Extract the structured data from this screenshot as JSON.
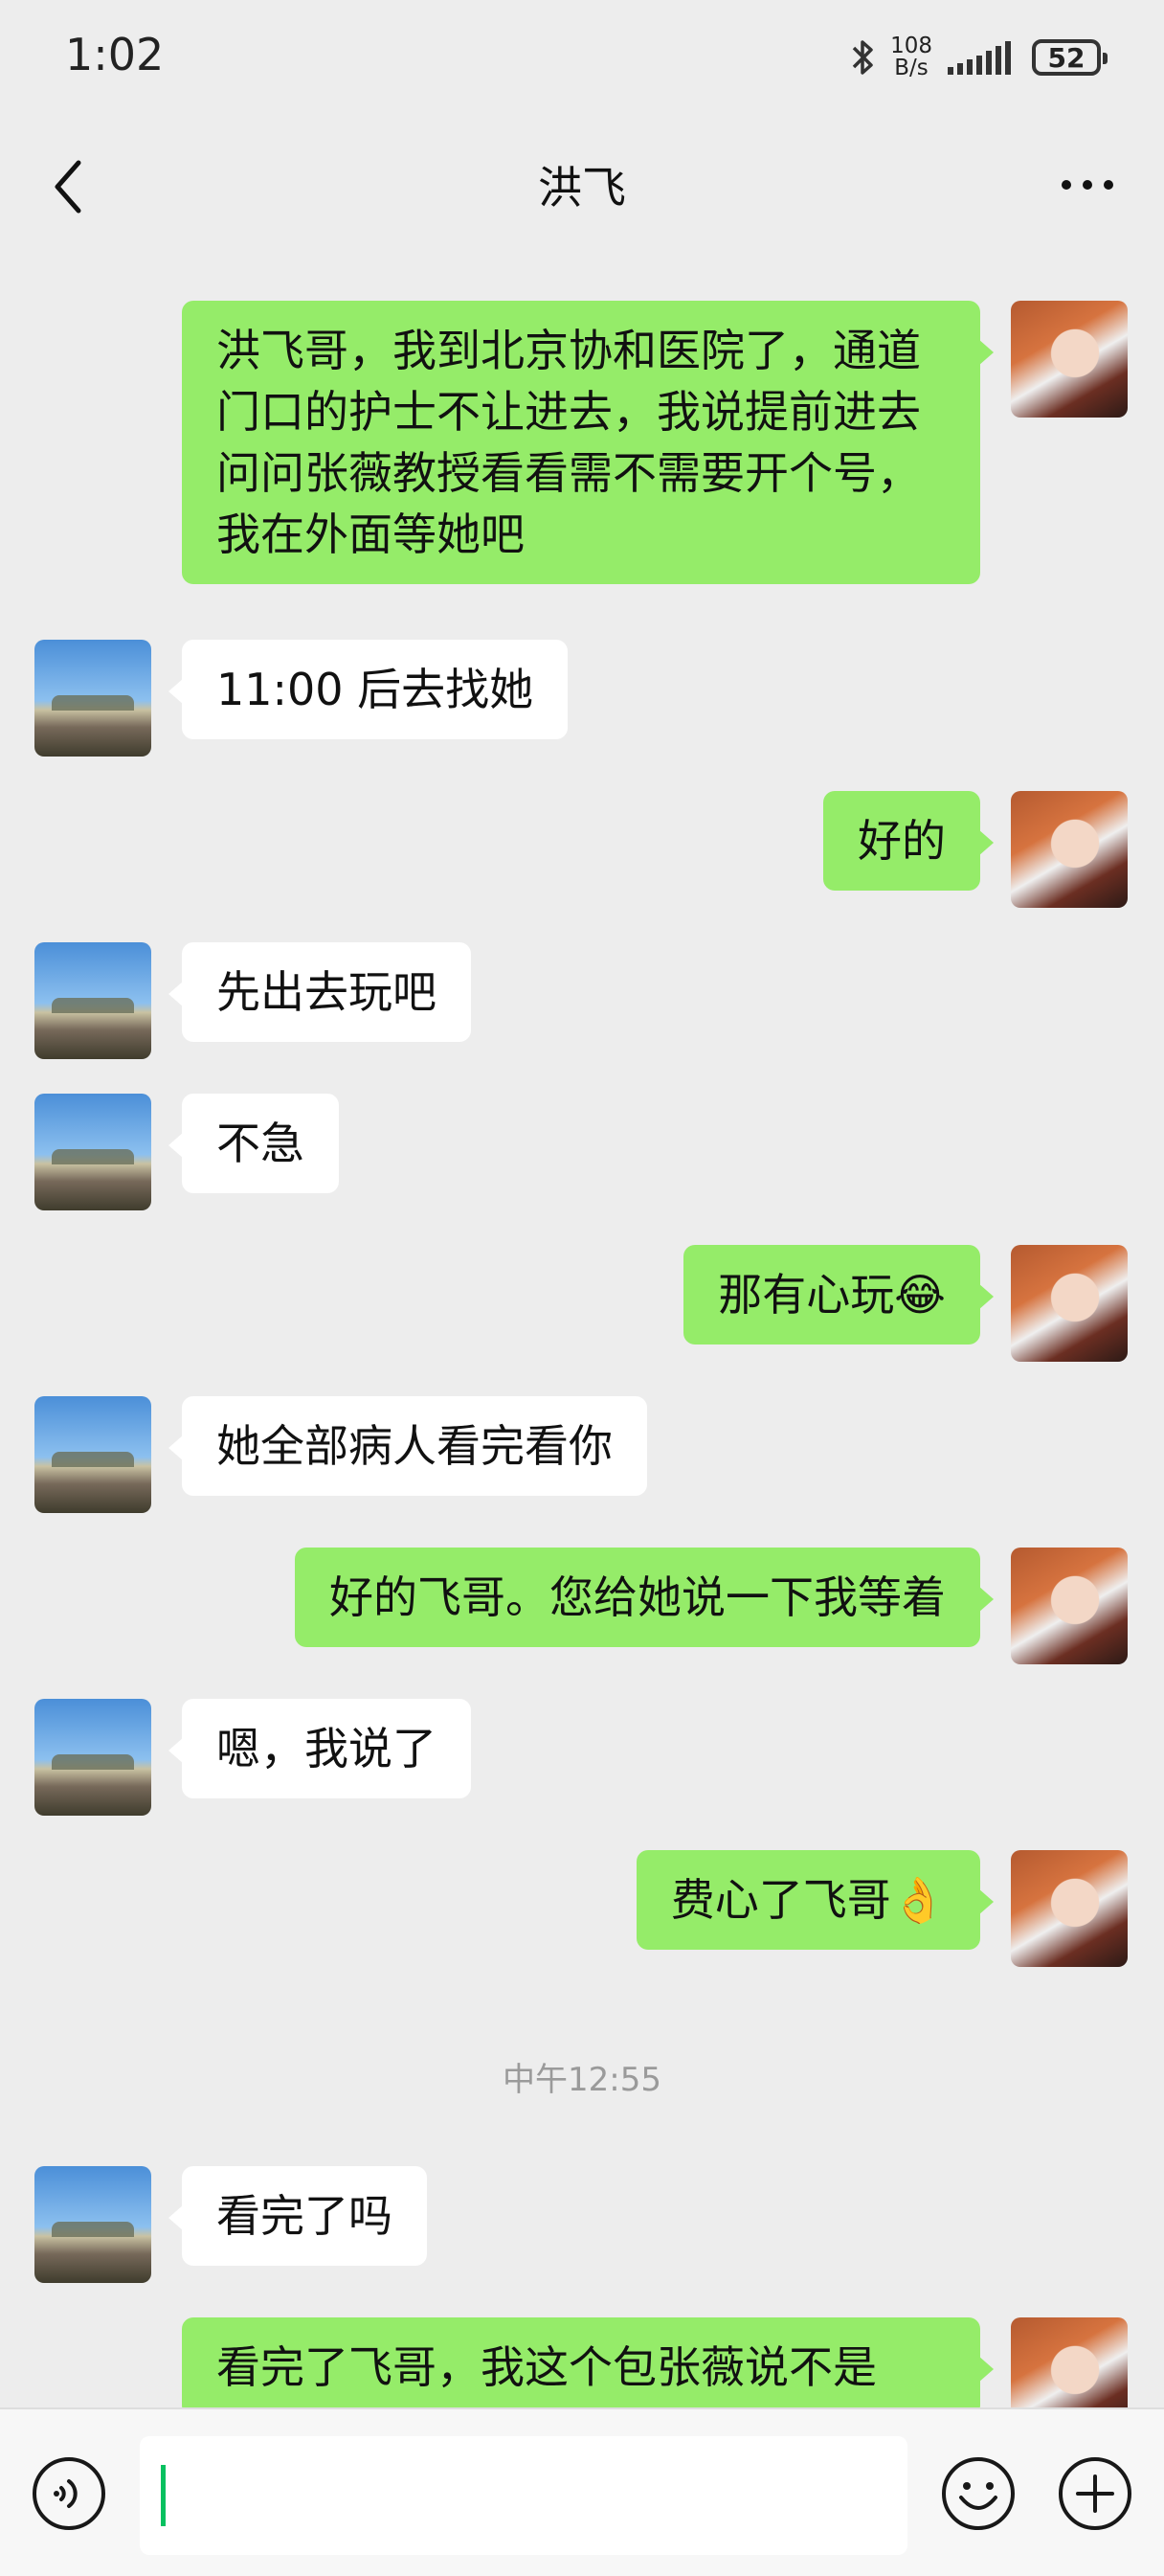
{
  "status_bar": {
    "time": "1:02",
    "net_speed_top": "108",
    "net_speed_bottom": "B/s",
    "battery": "52",
    "icons": [
      "bluetooth-icon",
      "signal-icon",
      "battery-icon"
    ]
  },
  "header": {
    "title": "洪飞",
    "back_icon": "chevron-left-icon",
    "more_icon": "more-horizontal-icon"
  },
  "messages": [
    {
      "side": "out",
      "text": "洪飞哥，我到北京协和医院了，通道门口的护士不让进去，我说提前进去问问张薇教授看看需不需要开个号，我在外面等她吧"
    },
    {
      "side": "in",
      "text": "11:00 后去找她"
    },
    {
      "side": "out",
      "text": "好的"
    },
    {
      "side": "in",
      "text": "先出去玩吧"
    },
    {
      "side": "in",
      "text": "不急"
    },
    {
      "side": "out",
      "text": "那有心玩",
      "emoji": "😂"
    },
    {
      "side": "in",
      "text": "她全部病人看完看你"
    },
    {
      "side": "out",
      "text": "好的飞哥。您给她说一下我等着"
    },
    {
      "side": "in",
      "text": "嗯，我说了"
    },
    {
      "side": "out",
      "text": "费心了飞哥",
      "emoji": "👌"
    },
    {
      "side": "in",
      "text": "看完了吗"
    },
    {
      "side": "out",
      "text": "看完了飞哥，我这个包张薇说不是"
    }
  ],
  "time_separator": "中午12:55",
  "input_bar": {
    "voice_icon": "voice-icon",
    "input_value": "",
    "emoji_icon": "emoji-icon",
    "plus_icon": "plus-icon"
  },
  "colors": {
    "background": "#ededed",
    "outgoing_bubble": "#95ec69",
    "incoming_bubble": "#ffffff",
    "cursor": "#07c160"
  }
}
